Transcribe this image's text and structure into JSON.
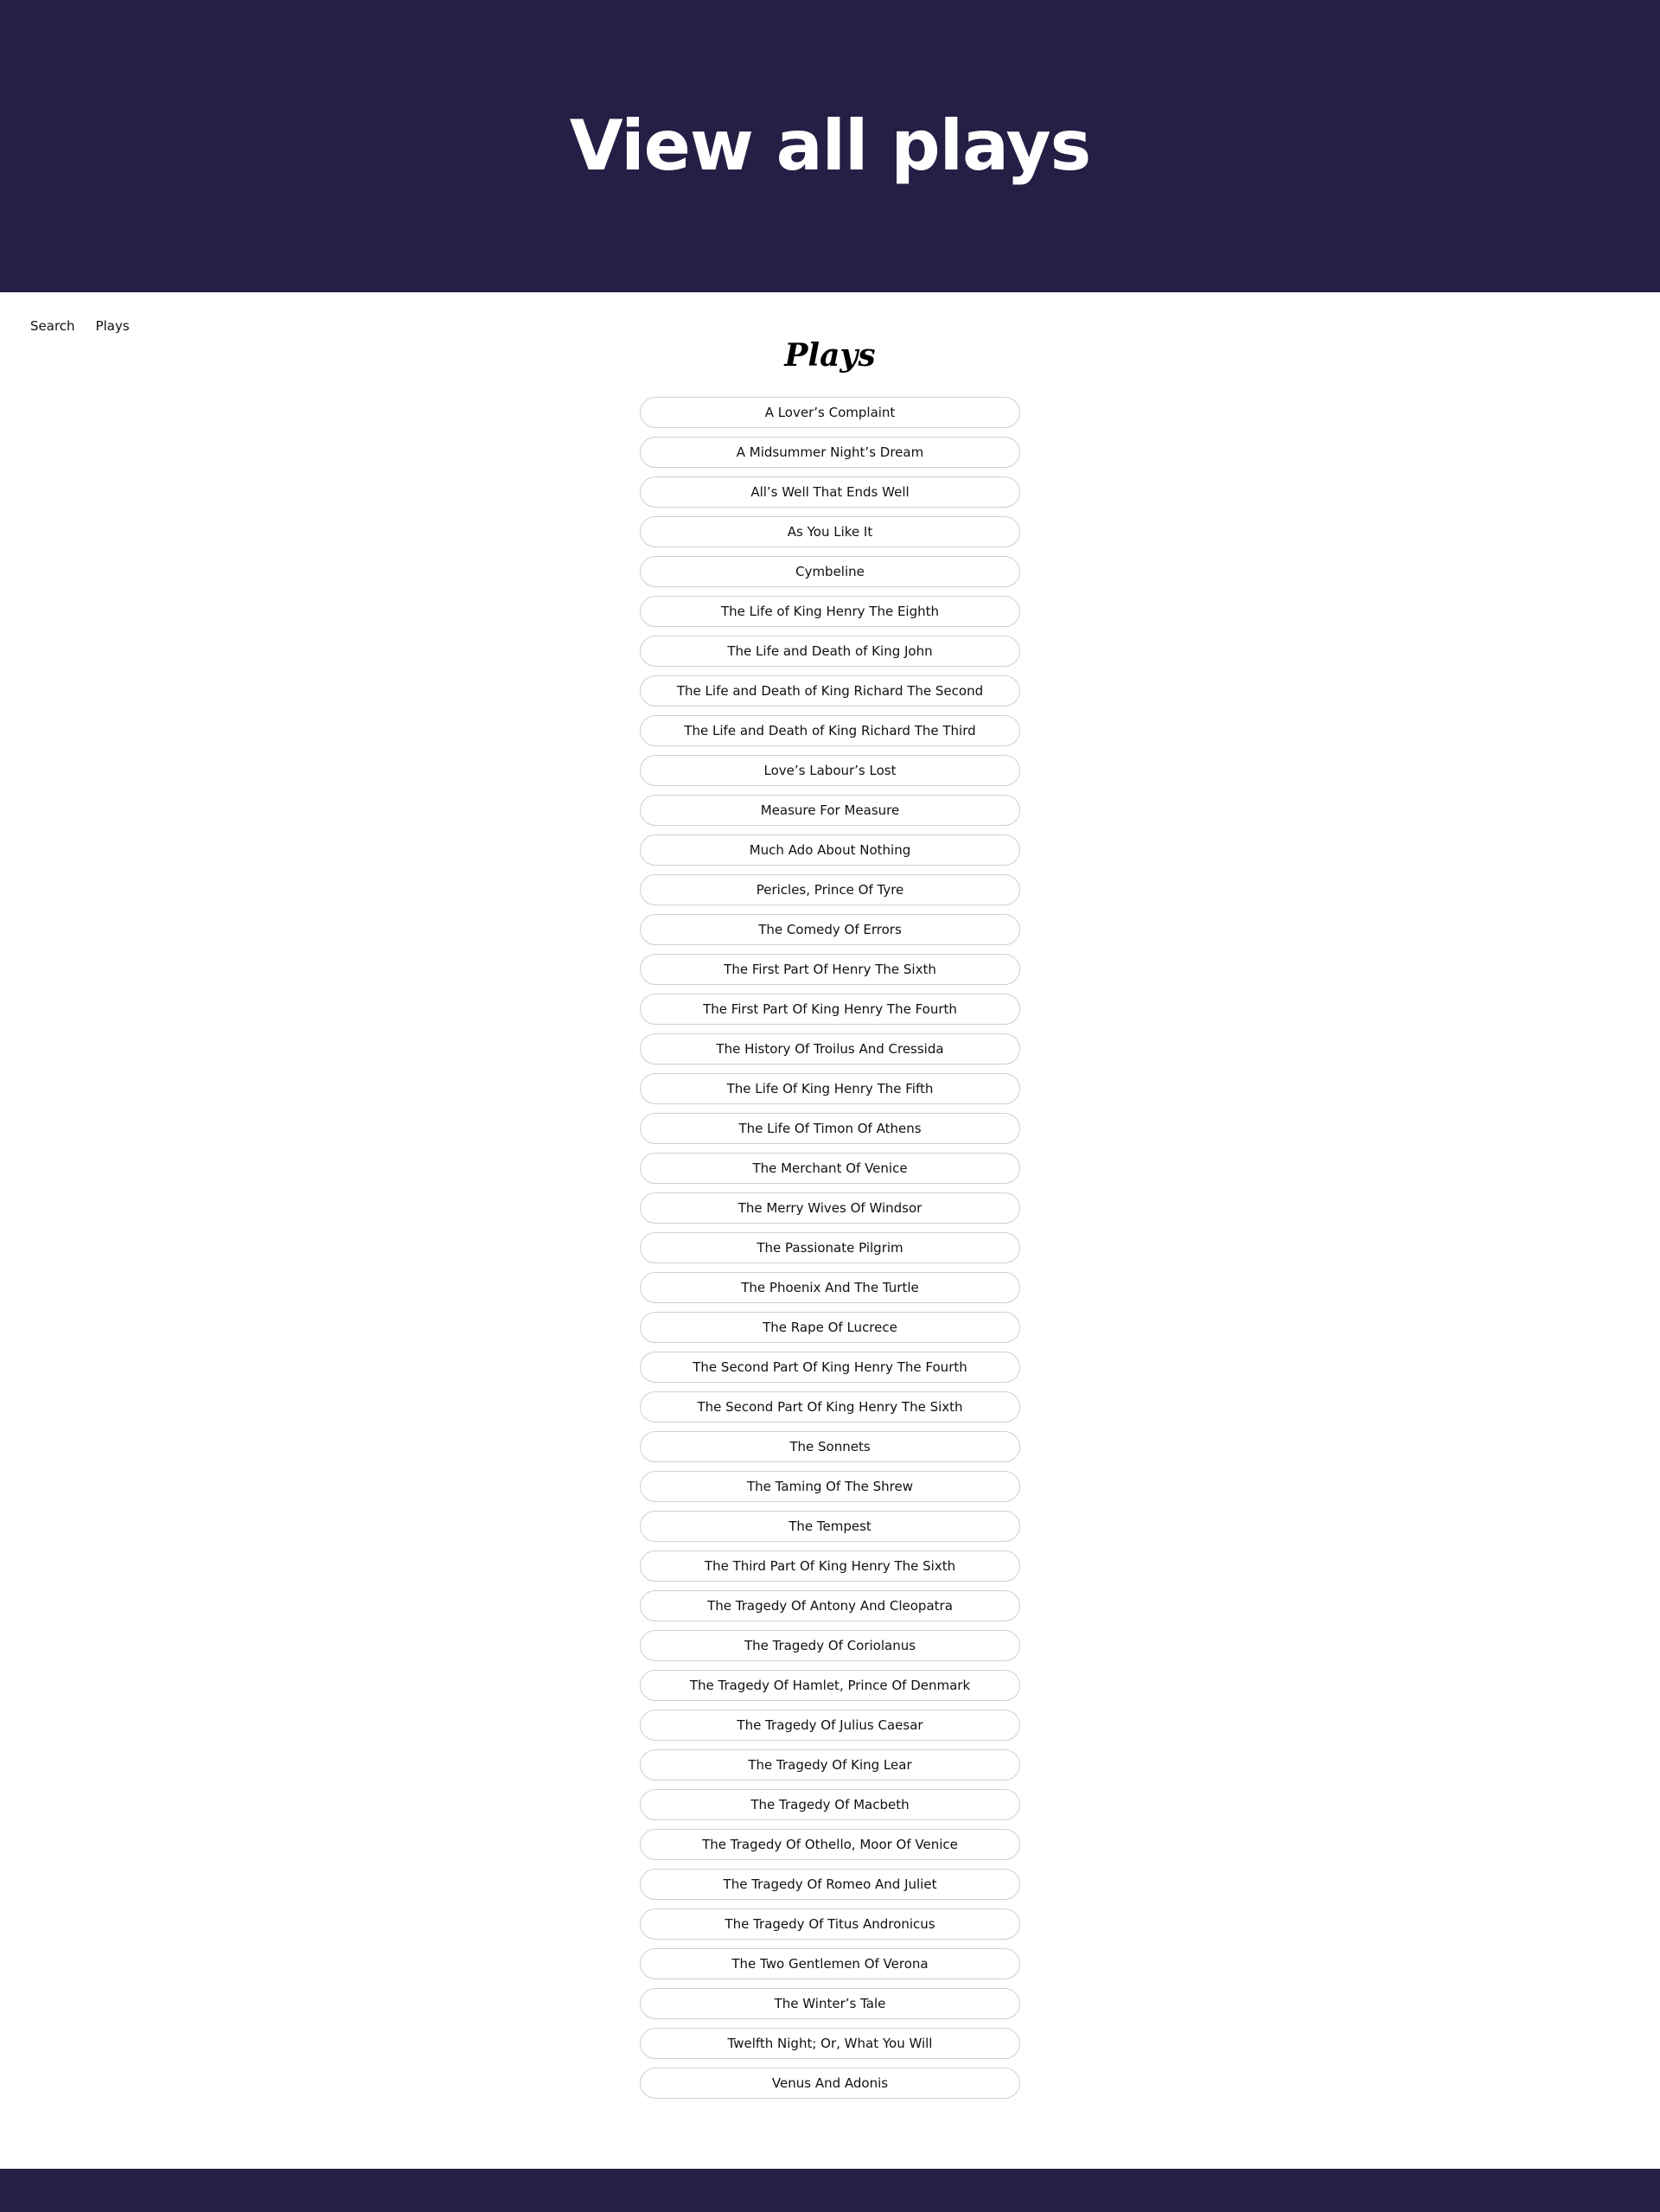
{
  "hero": {
    "title": "View all plays"
  },
  "nav": {
    "search_label": "Search",
    "plays_label": "Plays"
  },
  "section_title": "Plays",
  "colors": {
    "header_background": "#241f45",
    "item_border": "#cfcfcf"
  },
  "plays": [
    "A Lover’s Complaint",
    "A Midsummer Night’s Dream",
    "All’s Well That Ends Well",
    "As You Like It",
    "Cymbeline",
    "The Life of King Henry The Eighth",
    "The Life and Death of King John",
    "The Life and Death of King Richard The Second",
    "The Life and Death of King Richard The Third",
    "Love’s Labour’s Lost",
    "Measure For Measure",
    "Much Ado About Nothing",
    "Pericles, Prince Of Tyre",
    "The Comedy Of Errors",
    "The First Part Of Henry The Sixth",
    "The First Part Of King Henry The Fourth",
    "The History Of Troilus And Cressida",
    "The Life Of King Henry The Fifth",
    "The Life Of Timon Of Athens",
    "The Merchant Of Venice",
    "The Merry Wives Of Windsor",
    "The Passionate Pilgrim",
    "The Phoenix And The Turtle",
    "The Rape Of Lucrece",
    "The Second Part Of King Henry The Fourth",
    "The Second Part Of King Henry The Sixth",
    "The Sonnets",
    "The Taming Of The Shrew",
    "The Tempest",
    "The Third Part Of King Henry The Sixth",
    "The Tragedy Of Antony And Cleopatra",
    "The Tragedy Of Coriolanus",
    "The Tragedy Of Hamlet, Prince Of Denmark",
    "The Tragedy Of Julius Caesar",
    "The Tragedy Of King Lear",
    "The Tragedy Of Macbeth",
    "The Tragedy Of Othello, Moor Of Venice",
    "The Tragedy Of Romeo And Juliet",
    "The Tragedy Of Titus Andronicus",
    "The Two Gentlemen Of Verona",
    "The Winter’s Tale",
    "Twelfth Night; Or, What You Will",
    "Venus And Adonis"
  ]
}
